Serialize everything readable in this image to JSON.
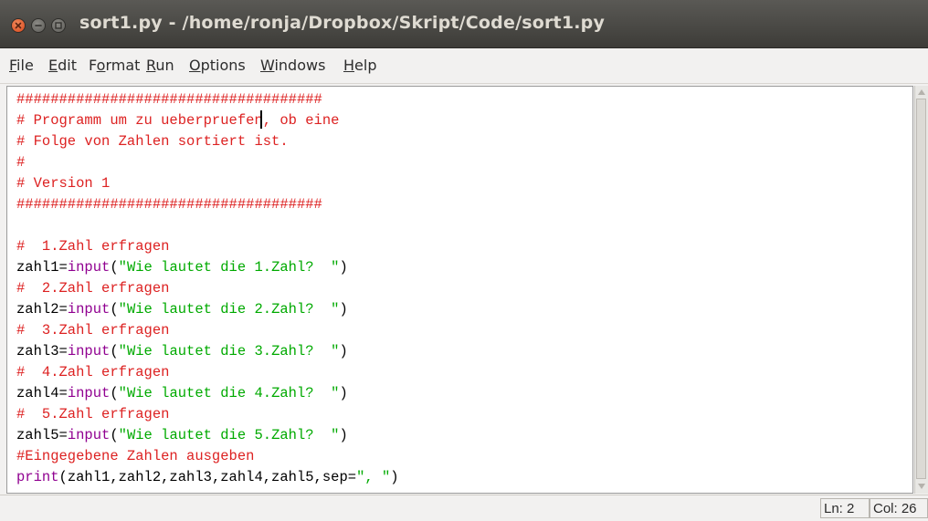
{
  "window": {
    "title": "sort1.py - /home/ronja/Dropbox/Skript/Code/sort1.py",
    "buttons": [
      "close-icon",
      "minimize-icon",
      "maximize-icon"
    ]
  },
  "menubar": {
    "items": [
      {
        "label": "File",
        "mnemonic": "F"
      },
      {
        "label": "Edit",
        "mnemonic": "E"
      },
      {
        "label": "Format",
        "mnemonic": "o"
      },
      {
        "label": "Run",
        "mnemonic": "R"
      },
      {
        "label": "Options",
        "mnemonic": "O"
      },
      {
        "label": "Windows",
        "mnemonic": "W"
      },
      {
        "label": "Help",
        "mnemonic": "H"
      }
    ]
  },
  "editor": {
    "lines": [
      [
        {
          "text": "####################################",
          "kind": "comment"
        }
      ],
      [
        {
          "text": "# Programm um zu ueberpruefen, ob eine",
          "kind": "comment"
        }
      ],
      [
        {
          "text": "# Folge von Zahlen sortiert ist.",
          "kind": "comment"
        }
      ],
      [
        {
          "text": "#",
          "kind": "comment"
        }
      ],
      [
        {
          "text": "# Version 1",
          "kind": "comment"
        }
      ],
      [
        {
          "text": "####################################",
          "kind": "comment"
        }
      ],
      [],
      [
        {
          "text": "#  1.Zahl erfragen",
          "kind": "comment"
        }
      ],
      [
        {
          "text": "zahl1=",
          "kind": "default"
        },
        {
          "text": "input",
          "kind": "builtin"
        },
        {
          "text": "(",
          "kind": "default"
        },
        {
          "text": "\"Wie lautet die 1.Zahl?  \"",
          "kind": "string"
        },
        {
          "text": ")",
          "kind": "default"
        }
      ],
      [
        {
          "text": "#  2.Zahl erfragen",
          "kind": "comment"
        }
      ],
      [
        {
          "text": "zahl2=",
          "kind": "default"
        },
        {
          "text": "input",
          "kind": "builtin"
        },
        {
          "text": "(",
          "kind": "default"
        },
        {
          "text": "\"Wie lautet die 2.Zahl?  \"",
          "kind": "string"
        },
        {
          "text": ")",
          "kind": "default"
        }
      ],
      [
        {
          "text": "#  3.Zahl erfragen",
          "kind": "comment"
        }
      ],
      [
        {
          "text": "zahl3=",
          "kind": "default"
        },
        {
          "text": "input",
          "kind": "builtin"
        },
        {
          "text": "(",
          "kind": "default"
        },
        {
          "text": "\"Wie lautet die 3.Zahl?  \"",
          "kind": "string"
        },
        {
          "text": ")",
          "kind": "default"
        }
      ],
      [
        {
          "text": "#  4.Zahl erfragen",
          "kind": "comment"
        }
      ],
      [
        {
          "text": "zahl4=",
          "kind": "default"
        },
        {
          "text": "input",
          "kind": "builtin"
        },
        {
          "text": "(",
          "kind": "default"
        },
        {
          "text": "\"Wie lautet die 4.Zahl?  \"",
          "kind": "string"
        },
        {
          "text": ")",
          "kind": "default"
        }
      ],
      [
        {
          "text": "#  5.Zahl erfragen",
          "kind": "comment"
        }
      ],
      [
        {
          "text": "zahl5=",
          "kind": "default"
        },
        {
          "text": "input",
          "kind": "builtin"
        },
        {
          "text": "(",
          "kind": "default"
        },
        {
          "text": "\"Wie lautet die 5.Zahl?  \"",
          "kind": "string"
        },
        {
          "text": ")",
          "kind": "default"
        }
      ],
      [
        {
          "text": "#Eingegebene Zahlen ausgeben",
          "kind": "comment"
        }
      ],
      [
        {
          "text": "print",
          "kind": "builtin"
        },
        {
          "text": "(zahl1,zahl2,zahl3,zahl4,zahl5,sep=",
          "kind": "default"
        },
        {
          "text": "\", \"",
          "kind": "string"
        },
        {
          "text": ")",
          "kind": "default"
        }
      ]
    ]
  },
  "statusbar": {
    "line": "Ln: 2",
    "column": "Col: 26"
  },
  "colors": {
    "comment": "#dd2222",
    "builtin": "#900090",
    "string": "#00aa00",
    "default": "#000000",
    "close_button": "#e0582a"
  }
}
